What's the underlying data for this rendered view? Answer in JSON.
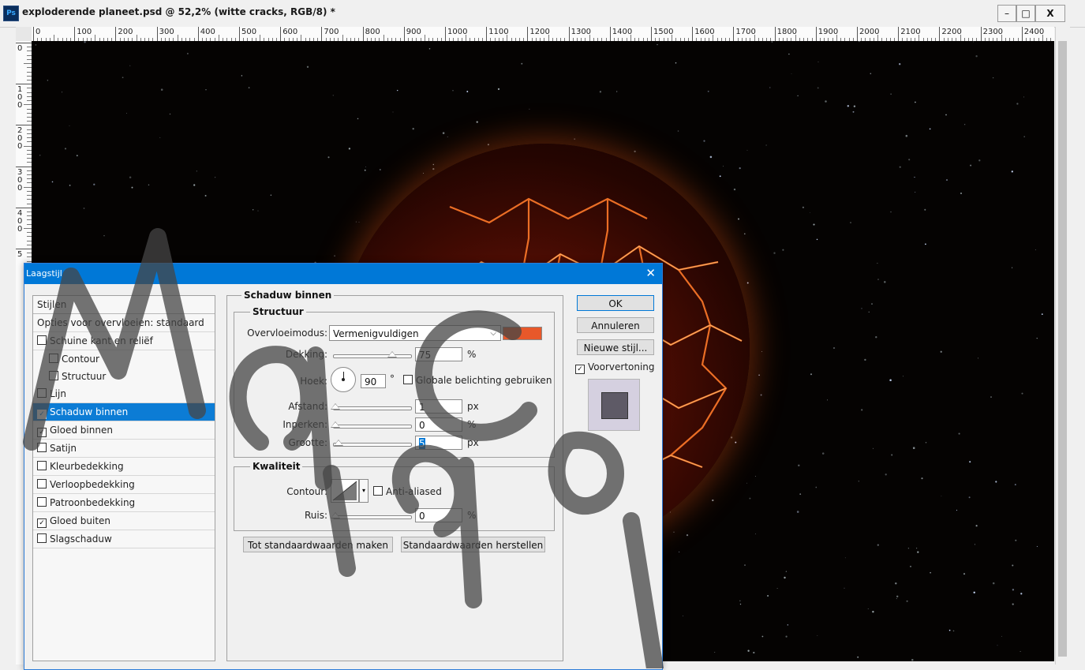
{
  "window": {
    "app_icon": "Ps",
    "title": "exploderende planeet.psd @ 52,2% (witte cracks, RGB/8) *",
    "minimize_label": "–",
    "maximize_label": "□",
    "close_label": "X"
  },
  "ruler": {
    "top_labels": [
      "0",
      "100",
      "200",
      "300",
      "400",
      "500",
      "600",
      "700",
      "800",
      "900",
      "1000",
      "1100",
      "1200",
      "1300",
      "1400",
      "1500",
      "1600",
      "1700",
      "1800",
      "1900",
      "2000",
      "2100",
      "2200",
      "2300",
      "2400"
    ],
    "left_labels": [
      [
        "0"
      ],
      [
        "1",
        "0",
        "0"
      ],
      [
        "2",
        "0",
        "0"
      ],
      [
        "3",
        "0",
        "0"
      ],
      [
        "4",
        "0",
        "0"
      ],
      [
        "5"
      ]
    ]
  },
  "dialog": {
    "title": "Laagstijl",
    "close_label": "✕",
    "styles_header": "Stijlen",
    "blend_options": "Opties voor overvloeien: standaard",
    "style_items": [
      {
        "label": "Schuine kant en reliëf",
        "checked": false,
        "sub": false,
        "selected": false
      },
      {
        "label": "Contour",
        "checked": false,
        "sub": true,
        "selected": false
      },
      {
        "label": "Structuur",
        "checked": false,
        "sub": true,
        "selected": false
      },
      {
        "label": "Lijn",
        "checked": false,
        "sub": false,
        "selected": false
      },
      {
        "label": "Schaduw binnen",
        "checked": true,
        "sub": false,
        "selected": true
      },
      {
        "label": "Gloed binnen",
        "checked": true,
        "sub": false,
        "selected": false
      },
      {
        "label": "Satijn",
        "checked": false,
        "sub": false,
        "selected": false
      },
      {
        "label": "Kleurbedekking",
        "checked": false,
        "sub": false,
        "selected": false
      },
      {
        "label": "Verloopbedekking",
        "checked": false,
        "sub": false,
        "selected": false
      },
      {
        "label": "Patroonbedekking",
        "checked": false,
        "sub": false,
        "selected": false
      },
      {
        "label": "Gloed buiten",
        "checked": true,
        "sub": false,
        "selected": false
      },
      {
        "label": "Slagschaduw",
        "checked": false,
        "sub": false,
        "selected": false
      }
    ],
    "section_title": "Schaduw binnen",
    "structure": {
      "title": "Structuur",
      "blend_mode_label": "Overvloeimodus:",
      "blend_mode_value": "Vermenigvuldigen",
      "color": "#e8582a",
      "opacity_label": "Dekking:",
      "opacity_value": "75",
      "opacity_unit": "%",
      "opacity_fraction": 0.75,
      "angle_label": "Hoek:",
      "angle_value": "90",
      "angle_unit": "°",
      "global_light_label": "Globale belichting gebruiken",
      "global_light_checked": false,
      "distance_label": "Afstand:",
      "distance_value": "1",
      "distance_unit": "px",
      "choke_label": "Inperken:",
      "choke_value": "0",
      "choke_unit": "%",
      "size_label": "Grootte:",
      "size_value": "5",
      "size_unit": "px"
    },
    "quality": {
      "title": "Kwaliteit",
      "contour_label": "Contour:",
      "antialias_label": "Anti-aliased",
      "antialias_checked": false,
      "noise_label": "Ruis:",
      "noise_value": "0",
      "noise_unit": "%"
    },
    "make_default_button": "Tot standaardwaarden maken",
    "reset_default_button": "Standaardwaarden herstellen",
    "ok_button": "OK",
    "cancel_button": "Annuleren",
    "new_style_button": "Nieuwe stijl...",
    "preview_label": "Voorvertoning",
    "preview_checked": true
  },
  "watermark": {
    "text": "Maigro Copy"
  }
}
